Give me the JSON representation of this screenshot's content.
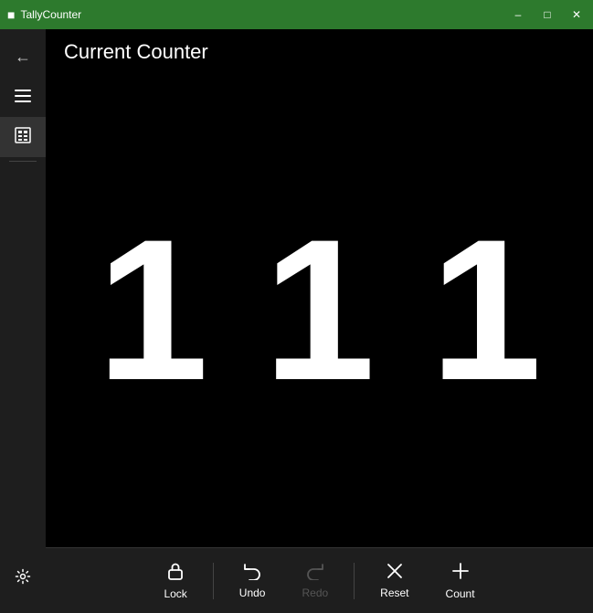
{
  "titlebar": {
    "title": "TallyCounter",
    "minimize": "–",
    "maximize": "□",
    "close": "✕"
  },
  "header": {
    "title": "Current Counter"
  },
  "counter": {
    "digits": [
      "1",
      "1",
      "1"
    ]
  },
  "sidebar": {
    "back_icon": "←",
    "menu_icon": "☰",
    "calculator_icon": "▦",
    "settings_icon": "⚙"
  },
  "toolbar": {
    "lock_label": "Lock",
    "undo_label": "Undo",
    "redo_label": "Redo",
    "reset_label": "Reset",
    "count_label": "Count"
  },
  "colors": {
    "titlebar_green": "#2d7a2d",
    "bg_dark": "#000000",
    "sidebar_bg": "#1e1e1e"
  }
}
